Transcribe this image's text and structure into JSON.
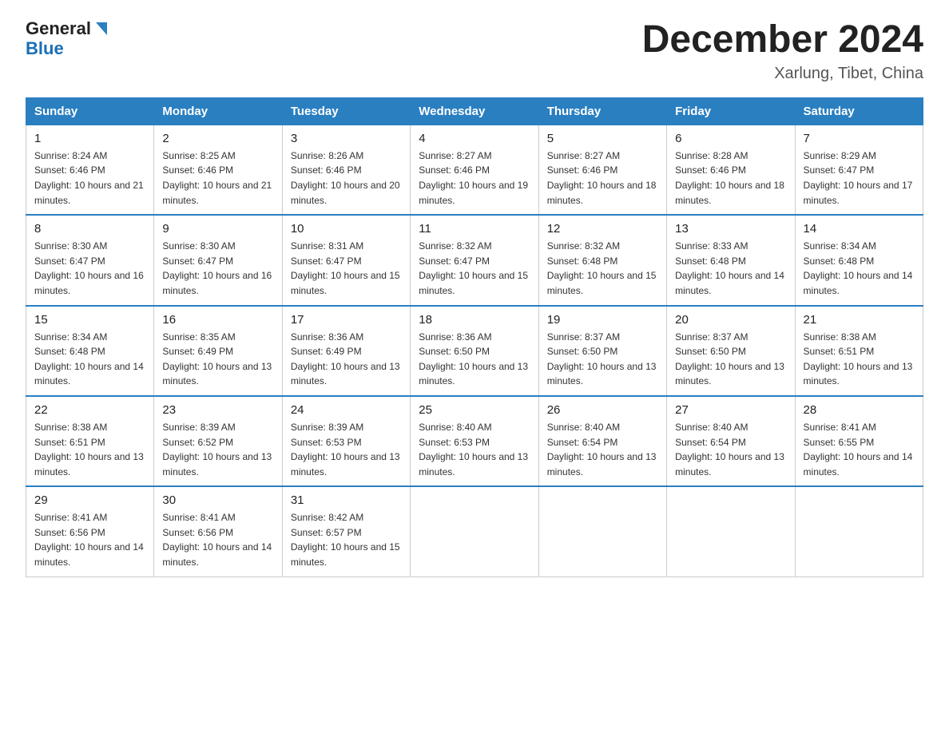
{
  "header": {
    "logo_general": "General",
    "logo_blue": "Blue",
    "month_title": "December 2024",
    "location": "Xarlung, Tibet, China"
  },
  "weekdays": [
    "Sunday",
    "Monday",
    "Tuesday",
    "Wednesday",
    "Thursday",
    "Friday",
    "Saturday"
  ],
  "weeks": [
    [
      {
        "day": "1",
        "sunrise": "8:24 AM",
        "sunset": "6:46 PM",
        "daylight": "10 hours and 21 minutes."
      },
      {
        "day": "2",
        "sunrise": "8:25 AM",
        "sunset": "6:46 PM",
        "daylight": "10 hours and 21 minutes."
      },
      {
        "day": "3",
        "sunrise": "8:26 AM",
        "sunset": "6:46 PM",
        "daylight": "10 hours and 20 minutes."
      },
      {
        "day": "4",
        "sunrise": "8:27 AM",
        "sunset": "6:46 PM",
        "daylight": "10 hours and 19 minutes."
      },
      {
        "day": "5",
        "sunrise": "8:27 AM",
        "sunset": "6:46 PM",
        "daylight": "10 hours and 18 minutes."
      },
      {
        "day": "6",
        "sunrise": "8:28 AM",
        "sunset": "6:46 PM",
        "daylight": "10 hours and 18 minutes."
      },
      {
        "day": "7",
        "sunrise": "8:29 AM",
        "sunset": "6:47 PM",
        "daylight": "10 hours and 17 minutes."
      }
    ],
    [
      {
        "day": "8",
        "sunrise": "8:30 AM",
        "sunset": "6:47 PM",
        "daylight": "10 hours and 16 minutes."
      },
      {
        "day": "9",
        "sunrise": "8:30 AM",
        "sunset": "6:47 PM",
        "daylight": "10 hours and 16 minutes."
      },
      {
        "day": "10",
        "sunrise": "8:31 AM",
        "sunset": "6:47 PM",
        "daylight": "10 hours and 15 minutes."
      },
      {
        "day": "11",
        "sunrise": "8:32 AM",
        "sunset": "6:47 PM",
        "daylight": "10 hours and 15 minutes."
      },
      {
        "day": "12",
        "sunrise": "8:32 AM",
        "sunset": "6:48 PM",
        "daylight": "10 hours and 15 minutes."
      },
      {
        "day": "13",
        "sunrise": "8:33 AM",
        "sunset": "6:48 PM",
        "daylight": "10 hours and 14 minutes."
      },
      {
        "day": "14",
        "sunrise": "8:34 AM",
        "sunset": "6:48 PM",
        "daylight": "10 hours and 14 minutes."
      }
    ],
    [
      {
        "day": "15",
        "sunrise": "8:34 AM",
        "sunset": "6:48 PM",
        "daylight": "10 hours and 14 minutes."
      },
      {
        "day": "16",
        "sunrise": "8:35 AM",
        "sunset": "6:49 PM",
        "daylight": "10 hours and 13 minutes."
      },
      {
        "day": "17",
        "sunrise": "8:36 AM",
        "sunset": "6:49 PM",
        "daylight": "10 hours and 13 minutes."
      },
      {
        "day": "18",
        "sunrise": "8:36 AM",
        "sunset": "6:50 PM",
        "daylight": "10 hours and 13 minutes."
      },
      {
        "day": "19",
        "sunrise": "8:37 AM",
        "sunset": "6:50 PM",
        "daylight": "10 hours and 13 minutes."
      },
      {
        "day": "20",
        "sunrise": "8:37 AM",
        "sunset": "6:50 PM",
        "daylight": "10 hours and 13 minutes."
      },
      {
        "day": "21",
        "sunrise": "8:38 AM",
        "sunset": "6:51 PM",
        "daylight": "10 hours and 13 minutes."
      }
    ],
    [
      {
        "day": "22",
        "sunrise": "8:38 AM",
        "sunset": "6:51 PM",
        "daylight": "10 hours and 13 minutes."
      },
      {
        "day": "23",
        "sunrise": "8:39 AM",
        "sunset": "6:52 PM",
        "daylight": "10 hours and 13 minutes."
      },
      {
        "day": "24",
        "sunrise": "8:39 AM",
        "sunset": "6:53 PM",
        "daylight": "10 hours and 13 minutes."
      },
      {
        "day": "25",
        "sunrise": "8:40 AM",
        "sunset": "6:53 PM",
        "daylight": "10 hours and 13 minutes."
      },
      {
        "day": "26",
        "sunrise": "8:40 AM",
        "sunset": "6:54 PM",
        "daylight": "10 hours and 13 minutes."
      },
      {
        "day": "27",
        "sunrise": "8:40 AM",
        "sunset": "6:54 PM",
        "daylight": "10 hours and 13 minutes."
      },
      {
        "day": "28",
        "sunrise": "8:41 AM",
        "sunset": "6:55 PM",
        "daylight": "10 hours and 14 minutes."
      }
    ],
    [
      {
        "day": "29",
        "sunrise": "8:41 AM",
        "sunset": "6:56 PM",
        "daylight": "10 hours and 14 minutes."
      },
      {
        "day": "30",
        "sunrise": "8:41 AM",
        "sunset": "6:56 PM",
        "daylight": "10 hours and 14 minutes."
      },
      {
        "day": "31",
        "sunrise": "8:42 AM",
        "sunset": "6:57 PM",
        "daylight": "10 hours and 15 minutes."
      },
      null,
      null,
      null,
      null
    ]
  ]
}
